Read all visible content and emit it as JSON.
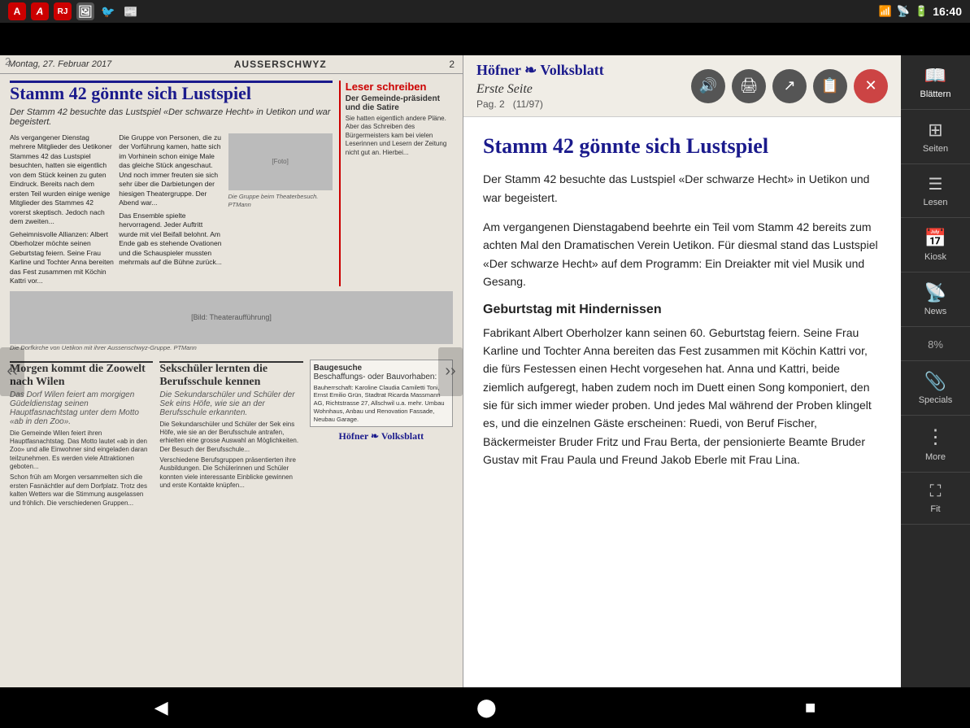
{
  "status_bar": {
    "time": "16:40",
    "icons": [
      "signal",
      "wifi",
      "battery"
    ]
  },
  "app_bar": {
    "icons": [
      "A",
      "A",
      "RJ",
      "img",
      "bird",
      "book"
    ]
  },
  "page_number": "2",
  "newspaper": {
    "date": "Montag, 27. Februar 2017",
    "section": "AUSSERSCHWYZ",
    "page": "2",
    "main_title": "Stamm 42 gönnte sich Lustspiel",
    "main_subtitle": "Der Stamm 42 besuchte das Lustspiel «Der schwarze Hecht» in Uetikon und war begeistert.",
    "side_title": "Leser schreiben",
    "side_subtitle": "Der Gemeinde-präsident und die Satire",
    "section2_title": "Morgen kommt die Zoowelt nach Wilen",
    "section2_sub": "Das Dorf Wilen feiert am morgigen Güdeldienstag seinen Hauptfasnachtstag unter dem Motto «ab in den Zoo».",
    "section3_title": "Sekschüler lernten die Berufsschule kennen",
    "section3_sub": "Die Sekundarschüler und Schüler der Sek eins Höfe, wie sie an der Berufsschule erkannten.",
    "bau_title": "Baugesuche",
    "bau_sub": "Beschaffungs- oder Bauvorhaben:",
    "logo": "Höfner ❧ Volksblatt"
  },
  "article": {
    "section": "Erste Seite",
    "pag": "Pag. 2",
    "issue": "(11/97)",
    "main_title": "Stamm 42 gönnte sich Lustspiel",
    "para1": "Der Stamm 42 besuchte das Lustspiel «Der schwarze Hecht» in Uetikon und war begeistert.",
    "para2": "Am vergangenen Dienstagabend beehrte ein Teil vom Stamm 42 bereits zum achten Mal den Dramatischen Verein Uetikon. Für diesmal stand das Lustspiel «Der schwarze Hecht» auf dem Programm: Ein Dreiakter mit viel Musik und Gesang.",
    "section_title": "Geburtstag mit Hindernissen",
    "para3": "Fabrikant Albert Oberholzer kann seinen 60. Geburtstag feiern. Seine Frau Karline und Tochter Anna bereiten das Fest zusammen mit Köchin Kattri vor, die fürs Festessen einen Hecht vorgesehen hat. Anna und Kattri, beide ziemlich aufgeregt, haben zudem noch im Duett einen Song komponiert, den sie für sich immer wieder proben. Und jedes Mal während der Proben klingelt es, und die einzelnen Gäste erscheinen: Ruedi, von Beruf Fischer, Bäckermeister Bruder Fritz und Frau Berta, der pensionierte Beamte Bruder Gustav mit Frau Paula und Freund Jakob Eberle mit Frau Lina.",
    "buttons": {
      "audio": "🔊",
      "print": "🖨",
      "share": "↗",
      "bookmark": "📋",
      "close": "✕"
    }
  },
  "sidebar": {
    "items": [
      {
        "id": "blaettern",
        "icon": "📖",
        "label": "Blättern"
      },
      {
        "id": "seiten",
        "icon": "⊞",
        "label": "Seiten"
      },
      {
        "id": "lesen",
        "icon": "≡",
        "label": "Lesen"
      },
      {
        "id": "kiosk",
        "icon": "📅",
        "label": "Kiosk"
      },
      {
        "id": "news",
        "icon": "📡",
        "label": "News"
      },
      {
        "id": "percent",
        "icon": "",
        "label": "8%"
      },
      {
        "id": "specials",
        "icon": "📎",
        "label": "Specials"
      },
      {
        "id": "more",
        "icon": "⋮",
        "label": "More"
      },
      {
        "id": "fit",
        "icon": "⛶",
        "label": "Fit"
      }
    ]
  },
  "bottom_bar": {
    "back": "◀",
    "home": "⬤",
    "recent": "■"
  }
}
